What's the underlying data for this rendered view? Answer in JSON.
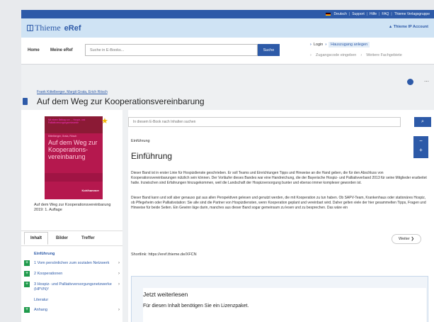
{
  "utilbar": {
    "lang": "Deutsch",
    "support": "Support",
    "hilfe": "Hilfe",
    "faq": "FAQ",
    "group": "Thieme Verlagsgruppe"
  },
  "header": {
    "brand": "Thieme",
    "product": "eRef",
    "account": "▲ Thieme IP Account"
  },
  "nav": {
    "home": "Home",
    "mine": "Meine eRef",
    "search_placeholder": "Suche in E-Books...",
    "search_button": "Suche",
    "login": "Login",
    "hauszugang": "Hauszugang anlegen",
    "zugangscode": "Zugangscode eingeben",
    "fachgebiete": "Weitere Fachgebiete"
  },
  "book": {
    "authors": "Frank Kittelberger, Margit Grata, Erich Rösch",
    "title": "Auf dem Weg zur Kooperationsvereinbarung",
    "cover_top": "Mit einem Beitrag von ... Hospiz- und Palliativversorgungsnetzwerke",
    "cover_authors": "Kittelberger, Grata, Rösch",
    "cover_title": "Auf dem Weg zur Kooperations-vereinbarung",
    "cover_publisher": "Kohlhammer",
    "caption": "Auf dem Weg zur Kooperationsvereinbarung 2019: 1. Auflage"
  },
  "tabs": [
    "Inhalt",
    "Bilder",
    "Treffer"
  ],
  "toc": {
    "current": "Einführung",
    "items": [
      {
        "label": "1 Vom persönlichen zum sozialen Netzwerk"
      },
      {
        "label": "2 Kooperationen"
      },
      {
        "label": "3 Hospiz- und Palliativversorgungsnetzwerke (HPVN)²"
      }
    ],
    "literatur": "Literatur",
    "anhang": "Anhang"
  },
  "main": {
    "search_placeholder": "In diesem E-Book nach Inhalten suchen",
    "breadcrumb": "Einführung",
    "chapter": "Einführung",
    "p1": "Dieser Band ist in erster Linie für Hospizdienste geschrieben. Er soll Teams und Einrichtungen Tipps und Hinweise an die Hand geben, die für den Abschluss von Kooperationsvereinbarungen nützlich sein können. Der Vorläufer dieses Bandes war eine Handreichung, die der Bayerische Hospiz- und Palliativverband 2013 für seine Mitglieder erarbeitet hatte. Inzwischen sind Erfahrungen hinzugekommen, weil die Landschaft der Hospizversorgung bunter und ebenso immer komplexer geworden ist.",
    "p2": "Dieser Band kann und soll aber genauso gut aus allen Perspektiven gelesen und genutzt werden, die mit Kooperation zu tun haben. Ob SAPV-Team, Krankenhaus oder stationäres Hospiz, ob Pflegeheim oder Palliativstation: Sie alle sind die Partner von Hospizdiensten, wenn Kooperation geplant und vereinbart wird. Daher gelten viele der hier gesammelten Tipps, Fragen und Hinweise für beide Seiten. Ein Gewinn läge darin, manches aus dieser Band sogar gemeinsam zu lesen und zu besprechen. Das wäre ein",
    "weiter": "Weiter ❯",
    "shortlink": "Shortlink: https://eref.thieme.de/XFCN",
    "lock_heading": "Jetzt weiterlesen",
    "lock_text": "Für diesen Inhalt benötigen Sie ein Lizenzpaket."
  }
}
